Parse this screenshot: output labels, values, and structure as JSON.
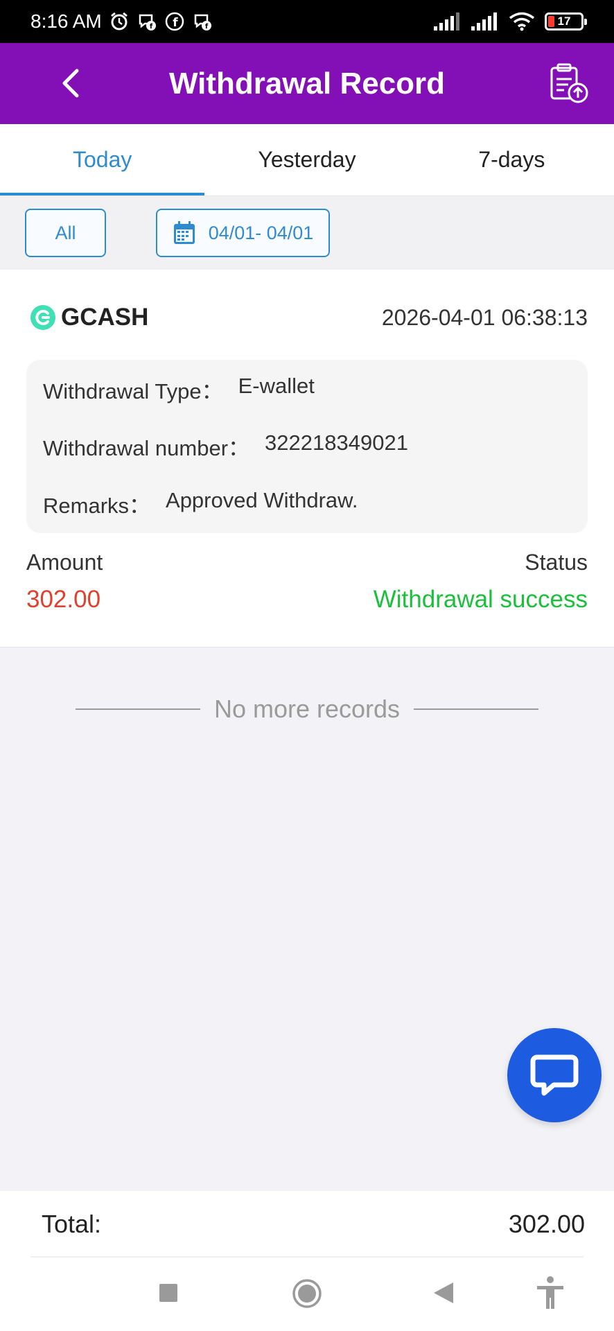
{
  "status_bar": {
    "time": "8:16 AM",
    "battery": "17",
    "icons": [
      "alarm-icon",
      "messenger-icon",
      "facebook-icon",
      "messenger-icon",
      "signal-icon",
      "signal-icon",
      "wifi-icon",
      "battery-icon"
    ]
  },
  "header": {
    "title": "Withdrawal Record",
    "back_icon": "chevron-left-icon",
    "action_icon": "clipboard-upload-icon"
  },
  "tabs": [
    {
      "label": "Today",
      "active": true
    },
    {
      "label": "Yesterday",
      "active": false
    },
    {
      "label": "7-days",
      "active": false
    }
  ],
  "filters": {
    "all_label": "All",
    "date_range": "04/01- 04/01",
    "date_icon": "calendar-icon"
  },
  "record": {
    "provider": "GCASH",
    "datetime": "2026-04-01 06:38:13",
    "type_label": "Withdrawal Type：",
    "type_value": "E-wallet",
    "number_label": "Withdrawal number：",
    "number_value": "322218349021",
    "remarks_label": "Remarks：",
    "remarks_value": "Approved Withdraw.",
    "amount_label": "Amount",
    "amount_value": "302.00",
    "status_label": "Status",
    "status_value": "Withdrawal success",
    "colors": {
      "amount": "#e0402e",
      "status": "#1cbf3b"
    }
  },
  "list_end": "No more records",
  "total": {
    "label": "Total:",
    "value": "302.00"
  },
  "colors": {
    "header_bg": "#8310b6",
    "accent": "#2f8bd1",
    "fab": "#1d5be0"
  }
}
